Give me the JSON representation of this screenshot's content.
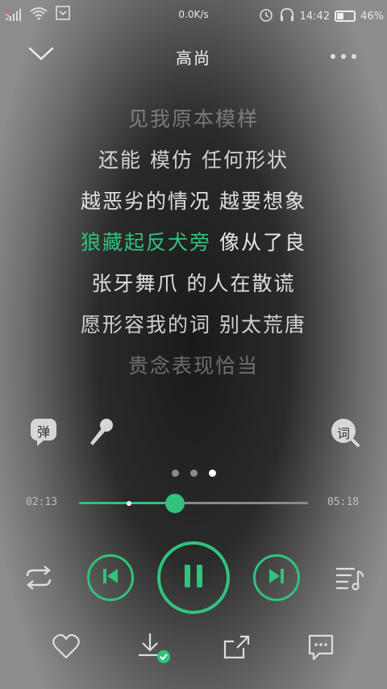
{
  "status_bar": {
    "network_speed": "0.0K/s",
    "time": "14:42",
    "battery_level": "46%",
    "battery_fraction": 0.46,
    "sim_slot": "2"
  },
  "header": {
    "title": "高尚",
    "collapse_icon": "chevron-down-icon",
    "more_icon": "more-dots-icon"
  },
  "lyrics": {
    "lines": [
      "见我原本模样",
      "还能 模仿 任何形状",
      "越恶劣的情况 越要想象",
      "像从了良",
      "张牙舞爪 的人在散谎",
      "愿形容我的词 别太荒唐",
      "贵念表现恰当"
    ],
    "current_highlight": "狼藏起反犬旁",
    "current_rest": " 像从了良"
  },
  "tools": {
    "danmaku_label": "弹",
    "lyrics_label": "词",
    "mic_icon": "microphone-icon"
  },
  "pages": {
    "count": 3,
    "active": 2
  },
  "progress": {
    "current": "02:13",
    "total": "05:18",
    "played_fraction": 0.42,
    "buffered_fraction": 0.22
  },
  "controls": {
    "repeat_icon": "repeat-icon",
    "prev_icon": "skip-previous-icon",
    "pause_icon": "pause-icon",
    "next_icon": "skip-next-icon",
    "playlist_icon": "playlist-icon"
  },
  "actions": {
    "favorite_icon": "heart-icon",
    "download_icon": "download-icon",
    "share_icon": "share-icon",
    "comment_icon": "comment-icon"
  },
  "colors": {
    "accent": "#31c27c"
  }
}
